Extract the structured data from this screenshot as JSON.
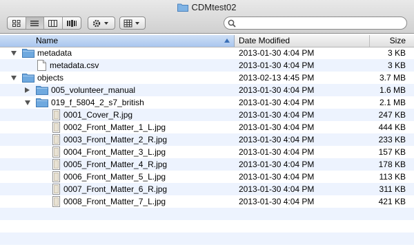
{
  "window": {
    "title": "CDMtest02"
  },
  "search": {
    "placeholder": "",
    "value": ""
  },
  "columns": {
    "name": "Name",
    "date": "Date Modified",
    "size": "Size"
  },
  "rows": [
    {
      "name": "metadata",
      "date": "2013-01-30 4:04 PM",
      "size": "3 KB",
      "kind": "folder",
      "level": 0,
      "disclosure": "open"
    },
    {
      "name": "metadata.csv",
      "date": "2013-01-30 4:04 PM",
      "size": "3 KB",
      "kind": "document",
      "level": 1,
      "disclosure": "none"
    },
    {
      "name": "objects",
      "date": "2013-02-13 4:45 PM",
      "size": "3.7 MB",
      "kind": "folder",
      "level": 0,
      "disclosure": "open"
    },
    {
      "name": "005_volunteer_manual",
      "date": "2013-01-30 4:04 PM",
      "size": "1.6 MB",
      "kind": "folder",
      "level": 1,
      "disclosure": "closed"
    },
    {
      "name": "019_f_5804_2_s7_british",
      "date": "2013-01-30 4:04 PM",
      "size": "2.1 MB",
      "kind": "folder",
      "level": 1,
      "disclosure": "open"
    },
    {
      "name": "0001_Cover_R.jpg",
      "date": "2013-01-30 4:04 PM",
      "size": "247 KB",
      "kind": "image",
      "level": 2,
      "disclosure": "none"
    },
    {
      "name": "0002_Front_Matter_1_L.jpg",
      "date": "2013-01-30 4:04 PM",
      "size": "444 KB",
      "kind": "image",
      "level": 2,
      "disclosure": "none"
    },
    {
      "name": "0003_Front_Matter_2_R.jpg",
      "date": "2013-01-30 4:04 PM",
      "size": "233 KB",
      "kind": "image",
      "level": 2,
      "disclosure": "none"
    },
    {
      "name": "0004_Front_Matter_3_L.jpg",
      "date": "2013-01-30 4:04 PM",
      "size": "157 KB",
      "kind": "image",
      "level": 2,
      "disclosure": "none"
    },
    {
      "name": "0005_Front_Matter_4_R.jpg",
      "date": "2013-01-30 4:04 PM",
      "size": "178 KB",
      "kind": "image",
      "level": 2,
      "disclosure": "none"
    },
    {
      "name": "0006_Front_Matter_5_L.jpg",
      "date": "2013-01-30 4:04 PM",
      "size": "113 KB",
      "kind": "image",
      "level": 2,
      "disclosure": "none"
    },
    {
      "name": "0007_Front_Matter_6_R.jpg",
      "date": "2013-01-30 4:04 PM",
      "size": "311 KB",
      "kind": "image",
      "level": 2,
      "disclosure": "none"
    },
    {
      "name": "0008_Front_Matter_7_L.jpg",
      "date": "2013-01-30 4:04 PM",
      "size": "421 KB",
      "kind": "image",
      "level": 2,
      "disclosure": "none"
    }
  ],
  "toolbar": {
    "view_buttons": [
      {
        "icon": "icon-view-icon",
        "active": false
      },
      {
        "icon": "list-view-icon",
        "active": true
      },
      {
        "icon": "column-view-icon",
        "active": false
      },
      {
        "icon": "cover-flow-icon",
        "active": false
      }
    ],
    "action_icon": "gear-icon",
    "arrange_icon": "arrange-grid-icon"
  },
  "colors": {
    "folder": "#6fa9df",
    "stripe": "#edf3fe",
    "sorted_header": "#a9c6ee"
  }
}
